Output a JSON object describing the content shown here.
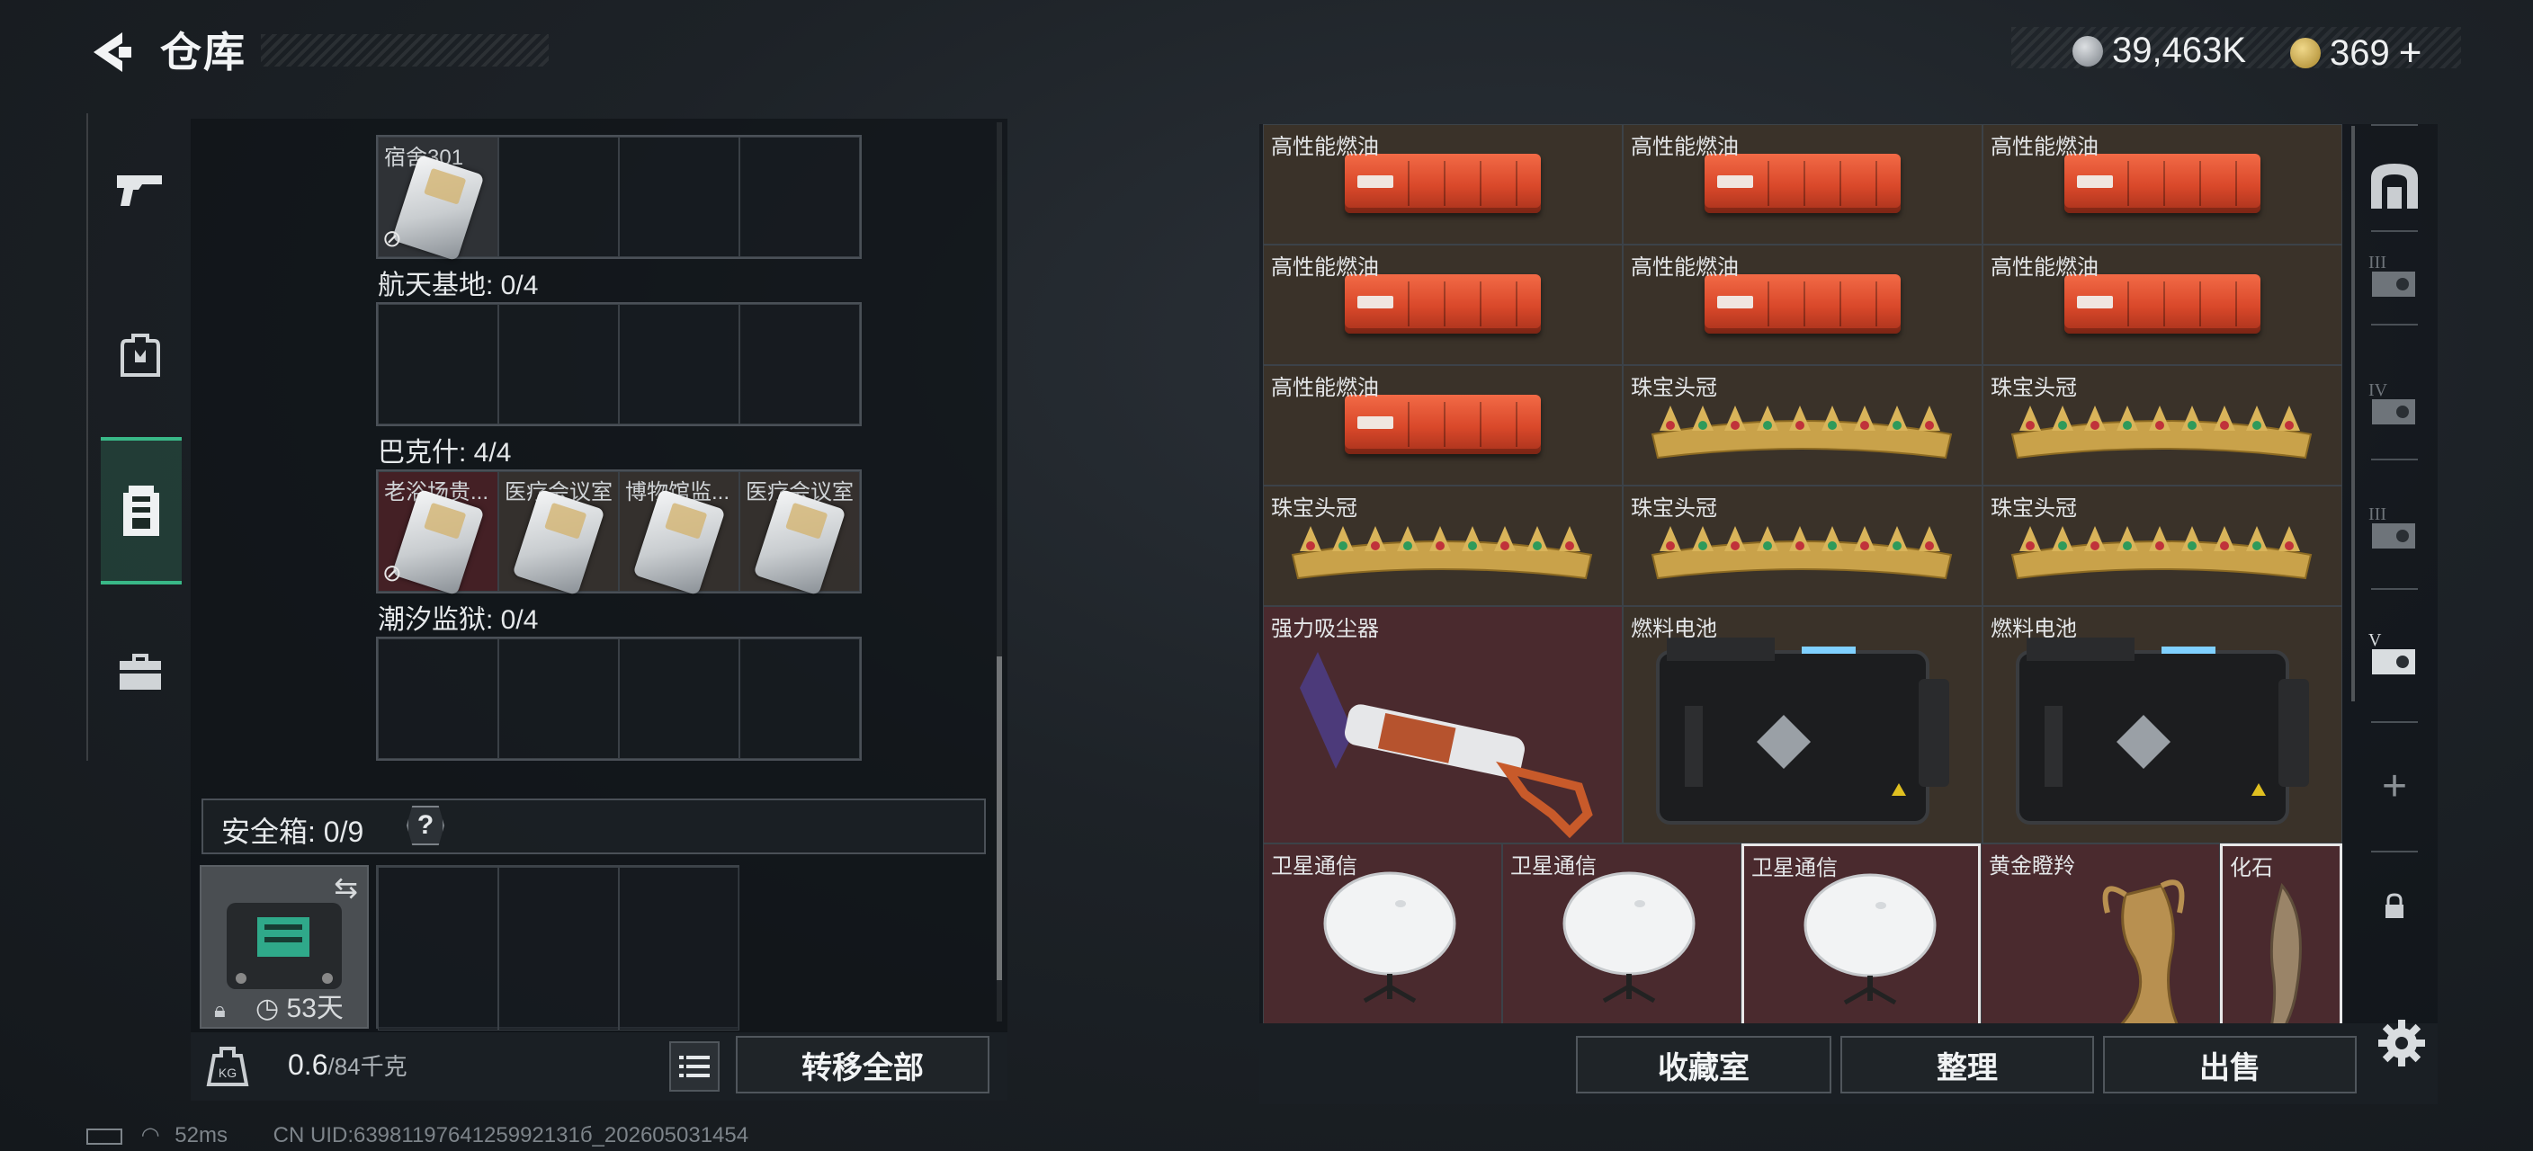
{
  "header": {
    "title": "仓库",
    "currency1": "39,463K",
    "currency2": "369",
    "currency2_add": "+"
  },
  "left_nav": {
    "items": [
      {
        "icon": "gun-icon",
        "active": false
      },
      {
        "icon": "backpack-icon",
        "active": false
      },
      {
        "icon": "vest-icon",
        "active": true
      },
      {
        "icon": "briefcase-icon",
        "active": false
      }
    ]
  },
  "key_sections": [
    {
      "title": "",
      "cells": [
        {
          "label": "宿舍301",
          "filled": true,
          "locked": true
        },
        {
          "label": ""
        },
        {
          "label": ""
        },
        {
          "label": ""
        }
      ]
    },
    {
      "title": "航天基地: 0/4",
      "cells": [
        {
          "label": ""
        },
        {
          "label": ""
        },
        {
          "label": ""
        },
        {
          "label": ""
        }
      ]
    },
    {
      "title": "巴克什: 4/4",
      "cells": [
        {
          "label": "老浴场贵...",
          "filled": true,
          "locked": true,
          "red": true
        },
        {
          "label": "医疗会议室",
          "filled": true
        },
        {
          "label": "博物馆监...",
          "filled": true
        },
        {
          "label": "医疗会议室",
          "filled": true
        }
      ]
    },
    {
      "title": "潮汐监狱: 0/4",
      "cells": [
        {
          "label": ""
        },
        {
          "label": ""
        },
        {
          "label": ""
        },
        {
          "label": ""
        }
      ]
    }
  ],
  "safebox": {
    "label": "安全箱: 0/9",
    "help": "?",
    "timer": "53天"
  },
  "bottom_left": {
    "weight_value": "0.6",
    "weight_max": "/84千克",
    "transfer_all": "转移全部"
  },
  "items": [
    {
      "label": "高性能燃油",
      "type": "fuel"
    },
    {
      "label": "高性能燃油",
      "type": "fuel"
    },
    {
      "label": "高性能燃油",
      "type": "fuel"
    },
    {
      "label": "高性能燃油",
      "type": "fuel"
    },
    {
      "label": "高性能燃油",
      "type": "fuel"
    },
    {
      "label": "高性能燃油",
      "type": "fuel"
    },
    {
      "label": "高性能燃油",
      "type": "fuel"
    },
    {
      "label": "珠宝头冠",
      "type": "crown"
    },
    {
      "label": "珠宝头冠",
      "type": "crown"
    },
    {
      "label": "珠宝头冠",
      "type": "crown"
    },
    {
      "label": "珠宝头冠",
      "type": "crown"
    },
    {
      "label": "珠宝头冠",
      "type": "crown"
    },
    {
      "label": "强力吸尘器",
      "type": "vacuum"
    },
    {
      "label": "燃料电池",
      "type": "battery"
    },
    {
      "label": "燃料电池",
      "type": "battery"
    },
    {
      "label": "卫星通信",
      "type": "dish"
    },
    {
      "label": "卫星通信",
      "type": "dish"
    },
    {
      "label": "卫星通信",
      "type": "dish",
      "selected": true
    },
    {
      "label": "黄金瞪羚",
      "type": "gazelle"
    },
    {
      "label": "化石",
      "type": "fossil",
      "selected": true
    }
  ],
  "right_nav": {
    "labels": [
      "III",
      "IV",
      "III",
      "V"
    ],
    "add": "+"
  },
  "bottom_right": {
    "collection": "收藏室",
    "organize": "整理",
    "sell": "出售"
  },
  "status": {
    "ping": "52ms",
    "uid": "CN UID:6398119764125992131б_202605031454"
  }
}
